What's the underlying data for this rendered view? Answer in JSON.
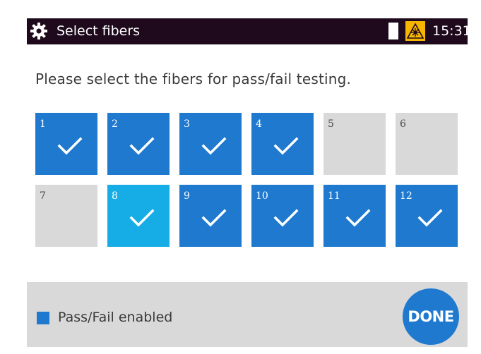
{
  "header": {
    "title": "Select fibers",
    "time": "15:31",
    "icons": {
      "settings": "gear-icon",
      "warning": "laser-warning-icon"
    },
    "colors": {
      "bar": "#1e0a1c",
      "warning": "#f6b600"
    }
  },
  "prompt": "Please select the fibers for pass/fail testing.",
  "fibers": [
    {
      "label": "1",
      "selected": true,
      "active": false
    },
    {
      "label": "2",
      "selected": true,
      "active": false
    },
    {
      "label": "3",
      "selected": true,
      "active": false
    },
    {
      "label": "4",
      "selected": true,
      "active": false
    },
    {
      "label": "5",
      "selected": false,
      "active": false
    },
    {
      "label": "6",
      "selected": false,
      "active": false
    },
    {
      "label": "7",
      "selected": false,
      "active": false
    },
    {
      "label": "8",
      "selected": true,
      "active": true
    },
    {
      "label": "9",
      "selected": true,
      "active": false
    },
    {
      "label": "10",
      "selected": true,
      "active": false
    },
    {
      "label": "11",
      "selected": true,
      "active": false
    },
    {
      "label": "12",
      "selected": true,
      "active": false
    }
  ],
  "footer": {
    "legend_label": "Pass/Fail enabled",
    "done_label": "DONE"
  },
  "colors": {
    "selected": "#1e79cf",
    "active": "#16ade6",
    "unselected": "#d9d9d9"
  }
}
